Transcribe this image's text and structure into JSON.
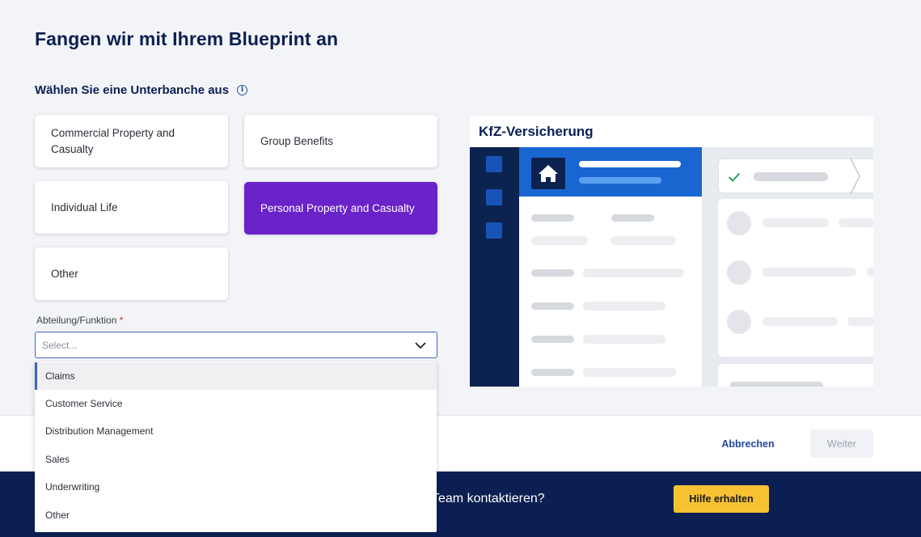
{
  "page": {
    "title": "Fangen wir mit Ihrem Blueprint an",
    "section_title": "Wählen Sie eine Unterbanche aus",
    "info_icon": "info-icon"
  },
  "subbranches": [
    {
      "label": "Commercial Property and Casualty",
      "selected": false
    },
    {
      "label": "Group Benefits",
      "selected": false
    },
    {
      "label": "Individual Life",
      "selected": false
    },
    {
      "label": "Personal Property and Casualty",
      "selected": true
    },
    {
      "label": "Other",
      "selected": false
    }
  ],
  "department": {
    "label": "Abteilung/Funktion",
    "required_mark": "*",
    "placeholder": "Select...",
    "options": [
      "Claims",
      "Customer Service",
      "Distribution Management",
      "Sales",
      "Underwriting",
      "Other"
    ],
    "highlighted": "Claims"
  },
  "preview": {
    "title": "KfZ-Versicherung"
  },
  "footer": {
    "cancel_label": "Abbrechen",
    "next_label": "Weiter"
  },
  "help": {
    "text": "Team kontaktieren?",
    "button_label": "Hilfe erhalten"
  },
  "colors": {
    "navy": "#0b1f52",
    "selected_purple": "#6a22c9",
    "help_yellow": "#f6c233",
    "focus_blue": "#3f64c8"
  }
}
